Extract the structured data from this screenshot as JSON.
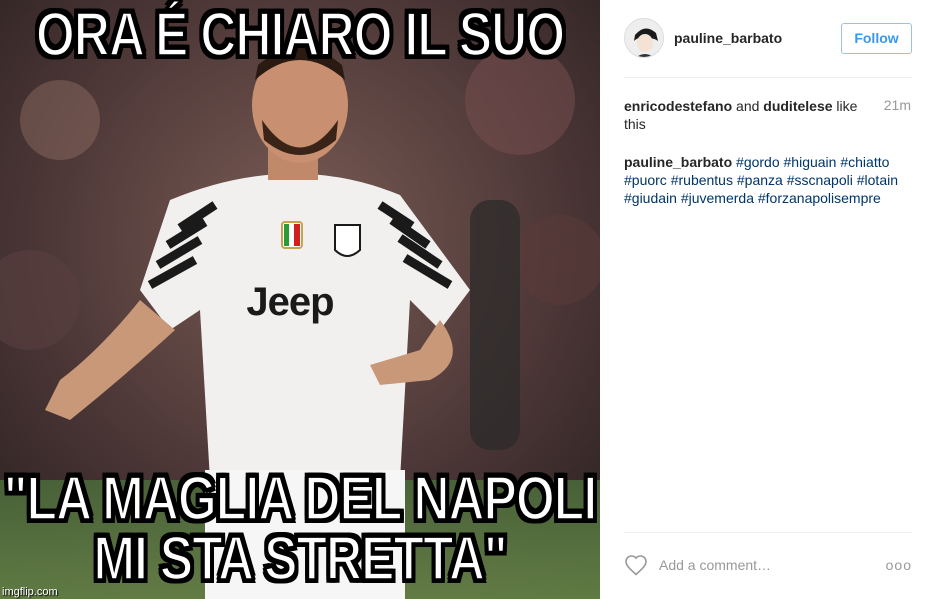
{
  "post": {
    "meme_top": "ORA É CHIARO IL SUO",
    "meme_bottom_line1": "\"LA MAGLIA DEL NAPOLI",
    "meme_bottom_line2": "MI STA STRETTA\"",
    "watermark": "imgflip.com",
    "jersey_text": "Jeep"
  },
  "header": {
    "username": "pauline_barbato",
    "follow_label": "Follow"
  },
  "likes": {
    "user1": "enricodestefano",
    "and": "and",
    "user2": "duditelese",
    "suffix": "like this",
    "time": "21m"
  },
  "caption": {
    "username": "pauline_barbato",
    "hashtags": [
      "#gordo",
      "#higuain",
      "#chiatto",
      "#puorc",
      "#rubentus",
      "#panza",
      "#sscnapoli",
      "#lotain",
      "#giudain",
      "#juvemerda",
      "#forzanapolisempre"
    ]
  },
  "comment": {
    "placeholder": "Add a comment…",
    "more_label": "ooo"
  },
  "colors": {
    "link": "#003569",
    "follow": "#3897f0",
    "muted": "#999999",
    "divider": "#efefef"
  },
  "icons": [
    "heart-icon",
    "more-options-icon",
    "avatar"
  ]
}
